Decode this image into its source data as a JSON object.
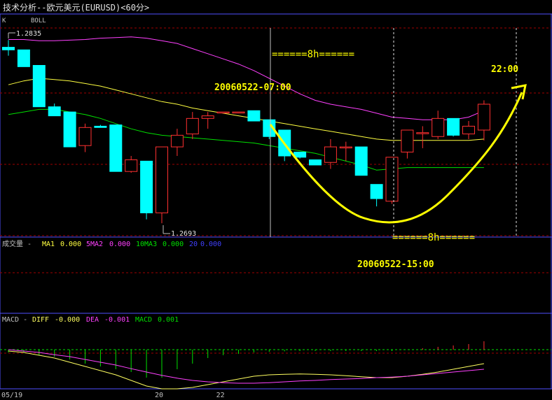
{
  "header": {
    "title": "技术分析--欧元美元(EURUSD)<60分>",
    "k_label": "K",
    "boll_label": "BOLL"
  },
  "annotations": {
    "high_price": "1.2835",
    "low_price": "1.2693",
    "time1": "20060522-07:00",
    "time2": "20060522-15:00",
    "time3": "22:00",
    "arrow_top": "======8h======",
    "arrow_bottom": "======8h======"
  },
  "volume_panel": {
    "title": "成交量 -",
    "ma1_label": "MA1",
    "ma1_value": "0.000",
    "ma2_label": "5MA2",
    "ma2_value": "0.000",
    "ma3_label": "10MA3",
    "ma3_value": "0.000",
    "ma4_label": "20",
    "ma4_value": "0.000"
  },
  "macd_panel": {
    "title": "MACD -",
    "diff_label": "DIFF",
    "diff_value": "-0.000",
    "dea_label": "DEA",
    "dea_value": "-0.001",
    "macd_label": "MACD",
    "macd_value": "0.001"
  },
  "x_axis": {
    "labels": [
      "05/19",
      "20",
      "22"
    ]
  },
  "colors": {
    "background": "#000000",
    "up_candle": "#ff3030",
    "down_candle": "#00ffff",
    "upper_band": "#ff40ff",
    "middle_band": "#ffff40",
    "lower_band": "#00e000",
    "grid": "#a00000",
    "panel_border": "#a00000",
    "annotation": "#ffff00",
    "macd_diff": "#ffff60",
    "macd_dea": "#ff40ff",
    "macd_bar": "#00e000",
    "frame": "#5050ff"
  },
  "chart_data": {
    "type": "candlestick",
    "title": "技术分析--欧元美元(EURUSD)<60分>",
    "ylim": [
      1.2685,
      1.2845
    ],
    "grid": true,
    "candles": [
      {
        "o": 1.2829,
        "h": 1.28345,
        "l": 1.28225,
        "c": 1.2827
      },
      {
        "o": 1.2827,
        "h": 1.2827,
        "l": 1.2814,
        "c": 1.2814
      },
      {
        "o": 1.2815,
        "h": 1.2815,
        "l": 1.2783,
        "c": 1.2783
      },
      {
        "o": 1.2783,
        "h": 1.27855,
        "l": 1.2777,
        "c": 1.2776
      },
      {
        "o": 1.2779,
        "h": 1.2779,
        "l": 1.2752,
        "c": 1.2752
      },
      {
        "o": 1.2753,
        "h": 1.277,
        "l": 1.2748,
        "c": 1.2767
      },
      {
        "o": 1.2768,
        "h": 1.2769,
        "l": 1.2767,
        "c": 1.2767
      },
      {
        "o": 1.2769,
        "h": 1.2769,
        "l": 1.2733,
        "c": 1.2733
      },
      {
        "o": 1.2733,
        "h": 1.2745,
        "l": 1.2732,
        "c": 1.2742
      },
      {
        "o": 1.2741,
        "h": 1.2741,
        "l": 1.2696,
        "c": 1.2701
      },
      {
        "o": 1.2701,
        "h": 1.2752,
        "l": 1.2693,
        "c": 1.2752
      },
      {
        "o": 1.2752,
        "h": 1.2766,
        "l": 1.2745,
        "c": 1.2761
      },
      {
        "o": 1.2762,
        "h": 1.2779,
        "l": 1.2758,
        "c": 1.2774
      },
      {
        "o": 1.2774,
        "h": 1.2779,
        "l": 1.2766,
        "c": 1.2776
      },
      {
        "o": 1.2779,
        "h": 1.2779,
        "l": 1.2779,
        "c": 1.2779
      },
      {
        "o": 1.2779,
        "h": 1.2779,
        "l": 1.2779,
        "c": 1.2779
      },
      {
        "o": 1.278,
        "h": 1.278,
        "l": 1.2772,
        "c": 1.2772
      },
      {
        "o": 1.2773,
        "h": 1.2773,
        "l": 1.2758,
        "c": 1.276
      },
      {
        "o": 1.2765,
        "h": 1.2765,
        "l": 1.2741,
        "c": 1.2745
      },
      {
        "o": 1.2748,
        "h": 1.2748,
        "l": 1.2743,
        "c": 1.2744
      },
      {
        "o": 1.2742,
        "h": 1.2742,
        "l": 1.2738,
        "c": 1.2738
      },
      {
        "o": 1.274,
        "h": 1.2758,
        "l": 1.2735,
        "c": 1.2752
      },
      {
        "o": 1.2752,
        "h": 1.2756,
        "l": 1.2741,
        "c": 1.2752
      },
      {
        "o": 1.2752,
        "h": 1.2752,
        "l": 1.273,
        "c": 1.273
      },
      {
        "o": 1.2723,
        "h": 1.2723,
        "l": 1.2706,
        "c": 1.2712
      },
      {
        "o": 1.271,
        "h": 1.2744,
        "l": 1.2708,
        "c": 1.2744
      },
      {
        "o": 1.2748,
        "h": 1.2765,
        "l": 1.2743,
        "c": 1.2765
      },
      {
        "o": 1.2763,
        "h": 1.2768,
        "l": 1.2751,
        "c": 1.2763
      },
      {
        "o": 1.276,
        "h": 1.278,
        "l": 1.2758,
        "c": 1.2774
      },
      {
        "o": 1.2774,
        "h": 1.2774,
        "l": 1.276,
        "c": 1.2761
      },
      {
        "o": 1.2762,
        "h": 1.2772,
        "l": 1.2758,
        "c": 1.2768
      },
      {
        "o": 1.2765,
        "h": 1.2788,
        "l": 1.2757,
        "c": 1.2785
      }
    ],
    "upper_band": [
      1.2835,
      1.2835,
      1.2834,
      1.2834,
      1.28345,
      1.2835,
      1.2836,
      1.28365,
      1.2837,
      1.2836,
      1.2834,
      1.2832,
      1.2828,
      1.2824,
      1.282,
      1.2816,
      1.2811,
      1.2805,
      1.2799,
      1.2793,
      1.2788,
      1.2785,
      1.2783,
      1.2781,
      1.2778,
      1.2775,
      1.2774,
      1.2773,
      1.2773,
      1.2773,
      1.2775,
      1.278
    ],
    "middle_band": [
      1.28,
      1.2803,
      1.2805,
      1.2804,
      1.2803,
      1.2801,
      1.2799,
      1.2796,
      1.2793,
      1.279,
      1.2787,
      1.2785,
      1.2782,
      1.278,
      1.2778,
      1.2776,
      1.2774,
      1.2772,
      1.277,
      1.2768,
      1.2766,
      1.2764,
      1.2762,
      1.276,
      1.2758,
      1.2757,
      1.2757,
      1.2757,
      1.2757,
      1.2757,
      1.2757,
      1.2758
    ],
    "lower_band": [
      1.2777,
      1.2779,
      1.2781,
      1.2781,
      1.2779,
      1.2777,
      1.2774,
      1.277,
      1.2766,
      1.2763,
      1.2761,
      1.276,
      1.2759,
      1.2758,
      1.2757,
      1.2756,
      1.2755,
      1.2753,
      1.2751,
      1.2749,
      1.2747,
      1.2744,
      1.2741,
      1.2738,
      1.2734,
      1.2735,
      1.2736,
      1.2736,
      1.2736,
      1.2736,
      1.2736,
      1.2736
    ],
    "macd": {
      "diff": [
        -5e-05,
        -0.0001,
        -0.0002,
        -0.0003,
        -0.00045,
        -0.0006,
        -0.00075,
        -0.0009,
        -0.0011,
        -0.0013,
        -0.0014,
        -0.0014,
        -0.00135,
        -0.00125,
        -0.00115,
        -0.00105,
        -0.00095,
        -0.0009,
        -0.00088,
        -0.00087,
        -0.00088,
        -0.0009,
        -0.00093,
        -0.00097,
        -0.001,
        -0.001,
        -0.00095,
        -0.00088,
        -0.0008,
        -0.0007,
        -0.0006,
        -0.0005
      ],
      "dea": [
        0.0,
        -5e-05,
        -0.0001,
        -0.00018,
        -0.00025,
        -0.00035,
        -0.00045,
        -0.00055,
        -0.00068,
        -0.0008,
        -0.00092,
        -0.00102,
        -0.0011,
        -0.00115,
        -0.00118,
        -0.0012,
        -0.0012,
        -0.00118,
        -0.00115,
        -0.00112,
        -0.0011,
        -0.00107,
        -0.00105,
        -0.00103,
        -0.001,
        -0.00098,
        -0.00095,
        -0.0009,
        -0.00085,
        -0.0008,
        -0.00075,
        -0.0007
      ],
      "hist": [
        -0.0001,
        -0.0001,
        -0.0002,
        -0.00025,
        -0.00035,
        -0.0005,
        -0.0006,
        -0.0007,
        -0.0008,
        -0.001,
        -0.001,
        -0.0007,
        -0.0005,
        -0.0003,
        -0.0002,
        -0.00015,
        -0.0001,
        -8e-05,
        -6e-05,
        -5e-05,
        -5e-05,
        -5e-05,
        -5e-05,
        -5e-05,
        -5e-05,
        -5e-05,
        0.0,
        5e-05,
        0.0001,
        0.00015,
        0.0002,
        0.0003
      ]
    },
    "x_labels": [
      {
        "index": 0,
        "text": "05/19"
      },
      {
        "index": 10,
        "text": "20"
      },
      {
        "index": 14,
        "text": "22"
      }
    ]
  }
}
